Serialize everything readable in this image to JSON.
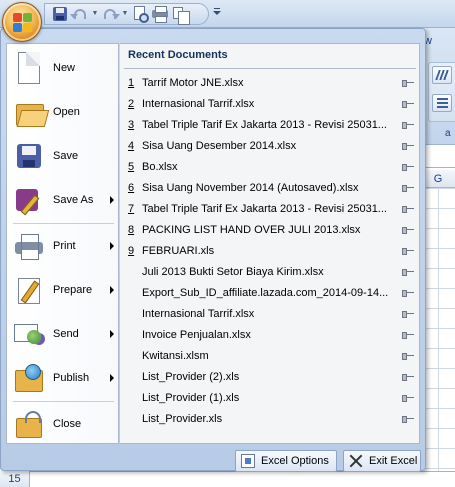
{
  "window": {
    "visible_tab_letter": "w",
    "column_header": "G",
    "row_number": "15",
    "group_label_fragment": "a"
  },
  "menu": {
    "commands": [
      {
        "label": "New",
        "icon": "new-document-icon",
        "has_submenu": false
      },
      {
        "label": "Open",
        "icon": "open-folder-icon",
        "has_submenu": false
      },
      {
        "label": "Save",
        "icon": "save-disk-icon",
        "has_submenu": false
      },
      {
        "label": "Save As",
        "icon": "save-as-icon",
        "has_submenu": true
      },
      {
        "label": "Print",
        "icon": "printer-icon",
        "has_submenu": true
      },
      {
        "label": "Prepare",
        "icon": "prepare-icon",
        "has_submenu": true
      },
      {
        "label": "Send",
        "icon": "send-icon",
        "has_submenu": true
      },
      {
        "label": "Publish",
        "icon": "publish-icon",
        "has_submenu": true
      },
      {
        "label": "Close",
        "icon": "close-folder-icon",
        "has_submenu": false
      }
    ],
    "recent_title": "Recent Documents",
    "recent": [
      {
        "num": "1",
        "name": "Tarrif Motor JNE.xlsx"
      },
      {
        "num": "2",
        "name": "Internasional Tarrif.xlsx"
      },
      {
        "num": "3",
        "name": "Tabel Triple Tarif Ex Jakarta 2013 - Revisi 25031..."
      },
      {
        "num": "4",
        "name": "Sisa Uang Desember 2014.xlsx"
      },
      {
        "num": "5",
        "name": "Bo.xlsx"
      },
      {
        "num": "6",
        "name": "Sisa Uang November 2014 (Autosaved).xlsx"
      },
      {
        "num": "7",
        "name": "Tabel Triple Tarif Ex Jakarta 2013 - Revisi 25031..."
      },
      {
        "num": "8",
        "name": "PACKING LIST HAND OVER JULI 2013.xlsx"
      },
      {
        "num": "9",
        "name": "FEBRUARI.xls"
      },
      {
        "num": "",
        "name": "Juli 2013 Bukti Setor Biaya Kirim.xlsx"
      },
      {
        "num": "",
        "name": "Export_Sub_ID_affiliate.lazada.com_2014-09-14..."
      },
      {
        "num": "",
        "name": "Internasional Tarrif.xlsx"
      },
      {
        "num": "",
        "name": "Invoice Penjualan.xlsx"
      },
      {
        "num": "",
        "name": "Kwitansi.xlsm"
      },
      {
        "num": "",
        "name": "List_Provider (2).xls"
      },
      {
        "num": "",
        "name": "List_Provider (1).xls"
      },
      {
        "num": "",
        "name": "List_Provider.xls"
      }
    ],
    "excel_options_label": "Excel Options",
    "exit_excel_label": "Exit Excel"
  }
}
